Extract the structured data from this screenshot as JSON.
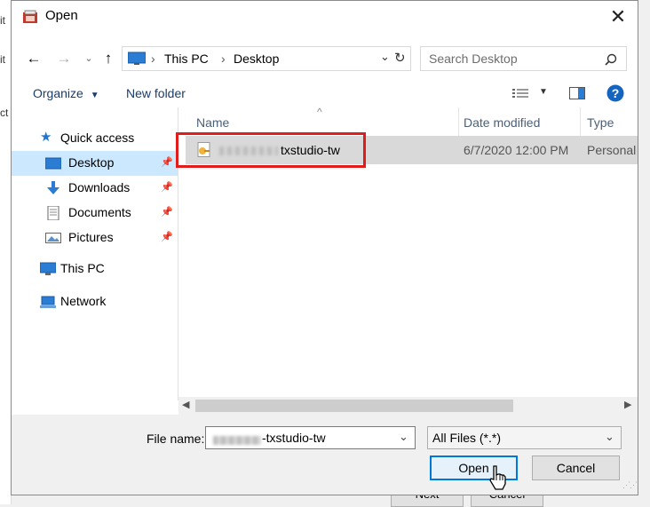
{
  "background_window": {
    "edge_fragments": [
      "it",
      "it",
      "ct"
    ],
    "buttons": [
      "Next",
      "Cancel"
    ]
  },
  "dialog": {
    "title": "Open",
    "address": {
      "crumbs": [
        "This PC",
        "Desktop"
      ]
    },
    "search": {
      "placeholder": "Search Desktop"
    },
    "commands": {
      "organize": "Organize",
      "new_folder": "New folder"
    },
    "navigation": {
      "quick_access": "Quick access",
      "items": [
        "Desktop",
        "Downloads",
        "Documents",
        "Pictures"
      ],
      "this_pc": "This PC",
      "network": "Network"
    },
    "columns": {
      "name": "Name",
      "date_modified": "Date modified",
      "type": "Type"
    },
    "files": [
      {
        "name": "txstudio-tw",
        "date_modified": "6/7/2020 12:00 PM",
        "type": "Personal I"
      }
    ],
    "file_name_label": "File name:",
    "file_name_value": "-txstudio-tw",
    "file_type": "All Files (*.*)",
    "open_label": "Open",
    "cancel_label": "Cancel"
  },
  "colors": {
    "accent": "#0078d7",
    "selection": "#cce8ff",
    "highlight_box": "#e21b1b"
  }
}
